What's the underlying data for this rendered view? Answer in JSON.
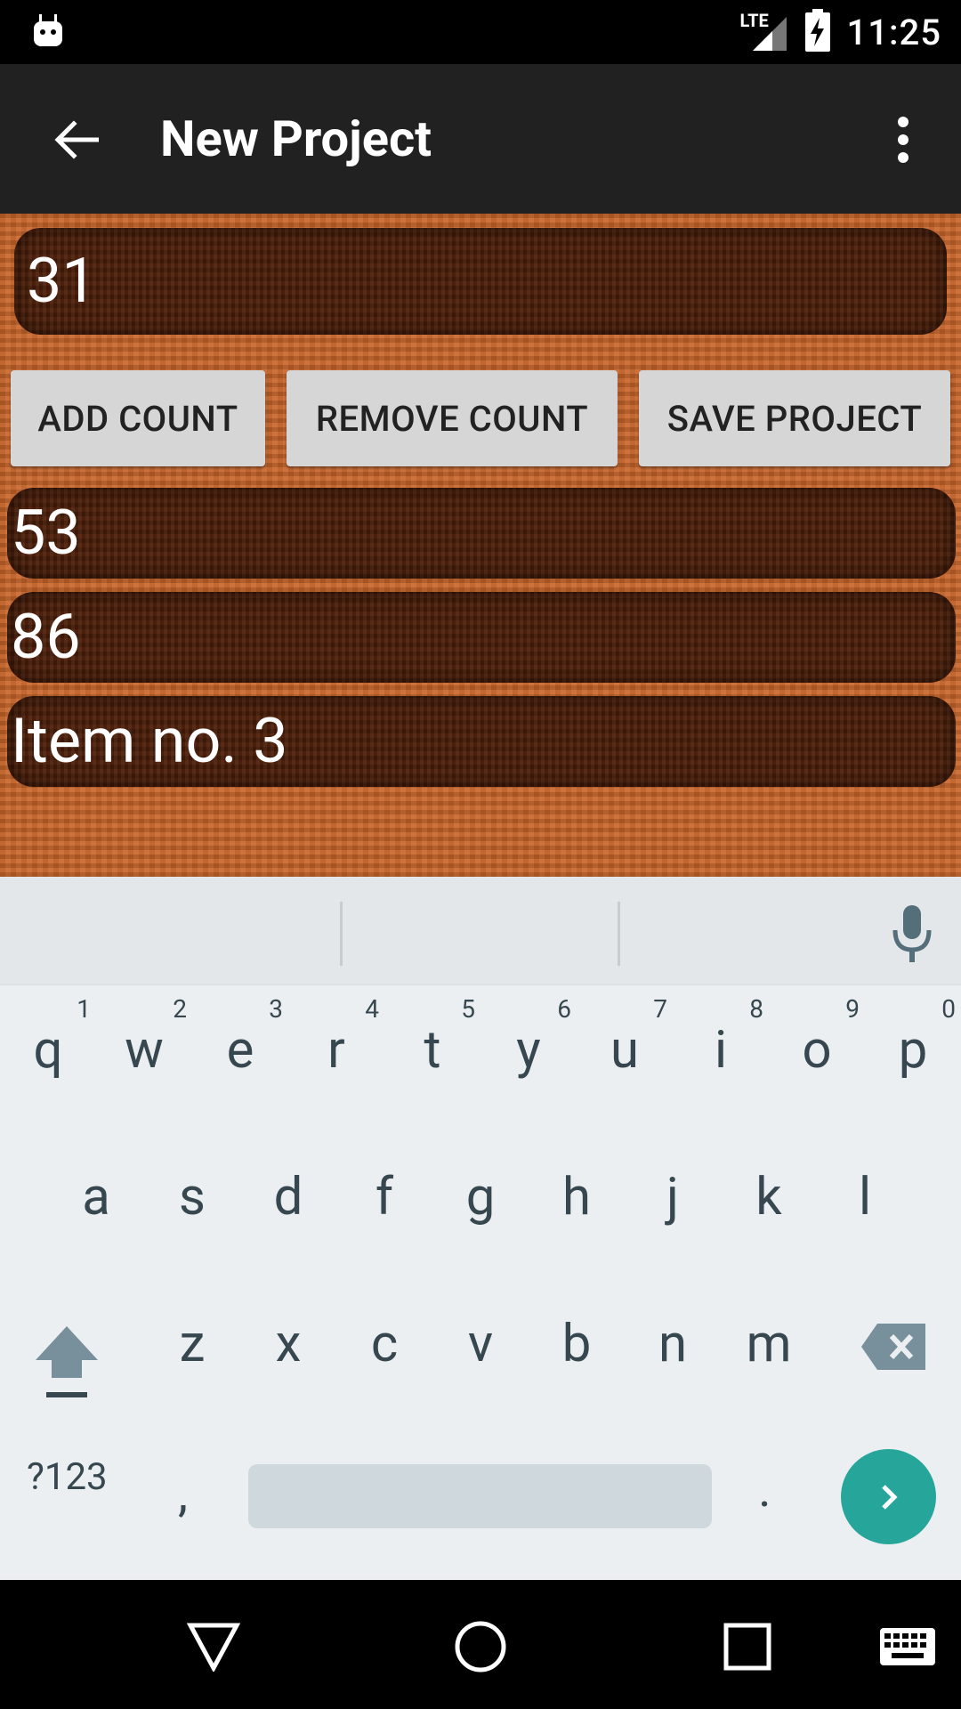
{
  "status_bar": {
    "time": "11:25",
    "network": "LTE"
  },
  "app_bar": {
    "title": "New Project"
  },
  "main_field": {
    "value": "31"
  },
  "buttons": {
    "add": "ADD COUNT",
    "remove": "REMOVE COUNT",
    "save": "SAVE PROJECT"
  },
  "list": [
    {
      "value": "53"
    },
    {
      "value": "86"
    },
    {
      "value": "Item no. 3"
    }
  ],
  "keyboard": {
    "row1": [
      {
        "key": "q",
        "hint": "1"
      },
      {
        "key": "w",
        "hint": "2"
      },
      {
        "key": "e",
        "hint": "3"
      },
      {
        "key": "r",
        "hint": "4"
      },
      {
        "key": "t",
        "hint": "5"
      },
      {
        "key": "y",
        "hint": "6"
      },
      {
        "key": "u",
        "hint": "7"
      },
      {
        "key": "i",
        "hint": "8"
      },
      {
        "key": "o",
        "hint": "9"
      },
      {
        "key": "p",
        "hint": "0"
      }
    ],
    "row2": [
      "a",
      "s",
      "d",
      "f",
      "g",
      "h",
      "j",
      "k",
      "l"
    ],
    "row3": [
      "z",
      "x",
      "c",
      "v",
      "b",
      "n",
      "m"
    ],
    "symbols_label": "?123",
    "comma": ",",
    "period": "."
  },
  "colors": {
    "accent": "#26a69a",
    "app_bar": "#212121",
    "fabric": "#c9652a",
    "field": "#4a1d08"
  },
  "icons": {
    "back": "arrow-left-icon",
    "overflow": "more-vert-icon",
    "mic": "microphone-icon",
    "shift": "shift-icon",
    "delete": "backspace-icon",
    "enter": "chevron-right-icon",
    "nav_back": "nav-back-icon",
    "nav_home": "nav-home-icon",
    "nav_recents": "nav-recents-icon",
    "nav_keyboard": "keyboard-icon"
  }
}
